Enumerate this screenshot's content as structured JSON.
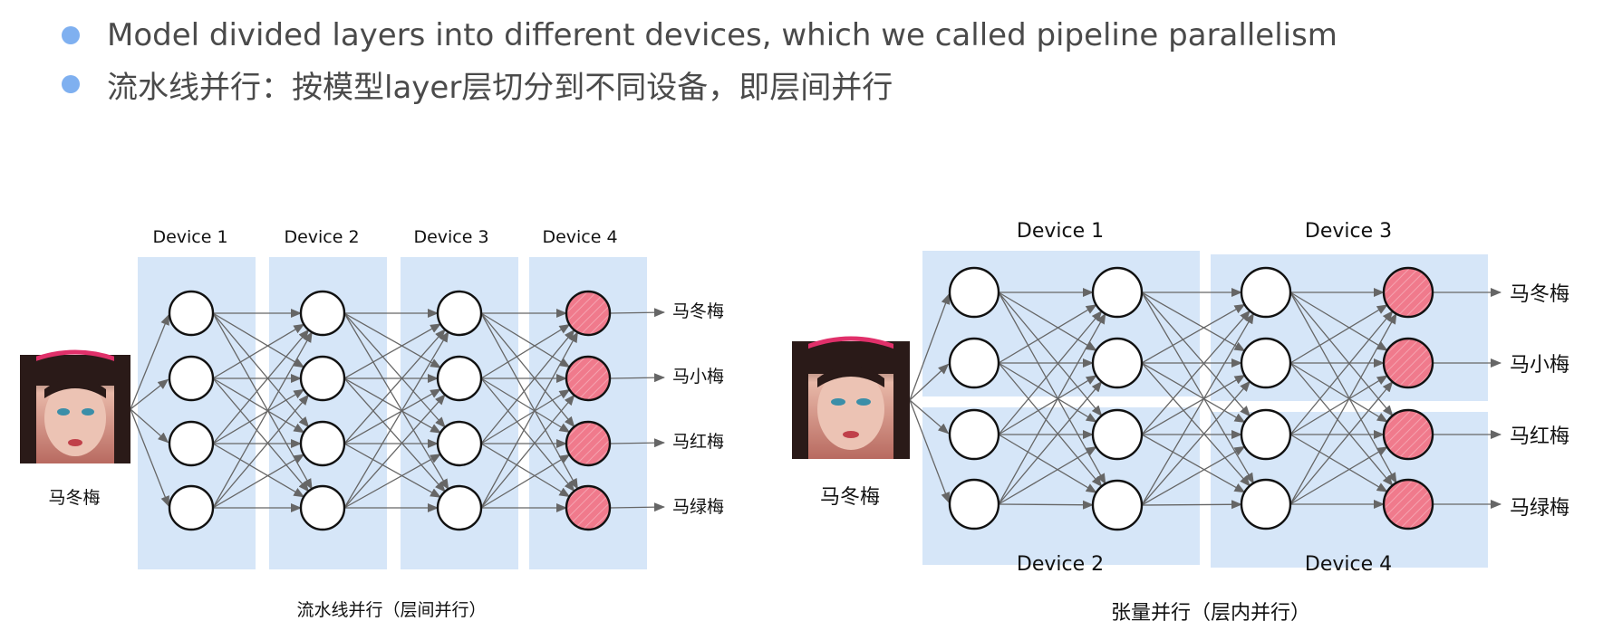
{
  "bullets": [
    {
      "text": "Model divided layers into different devices, which we called pipeline parallelism"
    },
    {
      "text": "流水线并行：按模型layer层切分到不同设备，即层间并行"
    }
  ],
  "left_diagram": {
    "devices": [
      "Device 1",
      "Device 2",
      "Device 3",
      "Device 4"
    ],
    "input_label": "马冬梅",
    "outputs": [
      "马冬梅",
      "马小梅",
      "马红梅",
      "马绿梅"
    ],
    "caption": "流水线并行（层间并行）"
  },
  "right_diagram": {
    "devices_top": [
      "Device 1",
      "Device 3"
    ],
    "devices_bottom": [
      "Device 2",
      "Device 4"
    ],
    "input_label": "马冬梅",
    "outputs": [
      "马冬梅",
      "马小梅",
      "马红梅",
      "马绿梅"
    ],
    "caption": "张量并行（层内并行）"
  },
  "colors": {
    "device_bg": "#d6e6f8",
    "output_node": "#f07a8c",
    "bullet": "#7fb0f0",
    "edge": "#666666"
  }
}
